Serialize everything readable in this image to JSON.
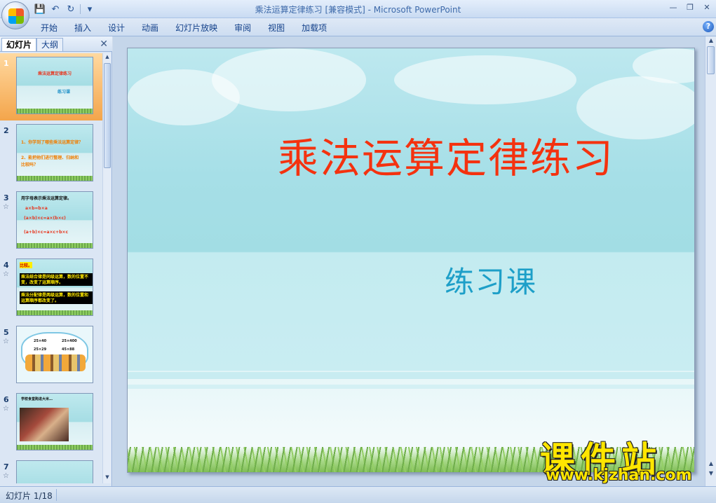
{
  "window": {
    "title": "乘法运算定律练习 [兼容模式] - Microsoft PowerPoint",
    "controls": [
      "—",
      "❐",
      "✕"
    ]
  },
  "qat": {
    "save": "💾",
    "undo": "↶",
    "redo": "↻",
    "more": "▾"
  },
  "ribbon": {
    "tabs": [
      "开始",
      "插入",
      "设计",
      "动画",
      "幻灯片放映",
      "审阅",
      "视图",
      "加载项"
    ],
    "help": "?"
  },
  "left_pane": {
    "tab_slides": "幻灯片",
    "tab_outline": "大纲",
    "close": "✕",
    "slides": [
      {
        "num": "1",
        "lines": [
          "乘法运算定律练习",
          "练习课"
        ]
      },
      {
        "num": "2",
        "lines": [
          "1、你学到了哪些乘法运算定律？",
          "2、能把他们进行整理、归纳和",
          "比较吗？"
        ]
      },
      {
        "num": "3",
        "lines": [
          "用字母表示乘法运算定律。",
          "a×b=b×a",
          "(a×b)×c=a×(b×c)",
          "(a+b)×c=a×c+b×c"
        ]
      },
      {
        "num": "4",
        "lines": [
          "比较。",
          "乘法结合律是同级运算，数的位置不变，改变了运算顺序。",
          "乘法分配律是两级运算，数的位置和运算顺序都改变了。"
        ]
      },
      {
        "num": "5",
        "lines": [
          "25×40",
          "25×400",
          "25×29",
          "45×88"
        ]
      },
      {
        "num": "6",
        "lines": [
          "学校食堂购进大米…"
        ]
      },
      {
        "num": "7",
        "lines": [
          ""
        ]
      }
    ]
  },
  "slide": {
    "title": "乘法运算定律练习",
    "subtitle": "练习课"
  },
  "watermark": {
    "big": "课件站",
    "url": "www.kjzhan.com"
  },
  "status": {
    "slide_count": "幻灯片 1/18"
  }
}
